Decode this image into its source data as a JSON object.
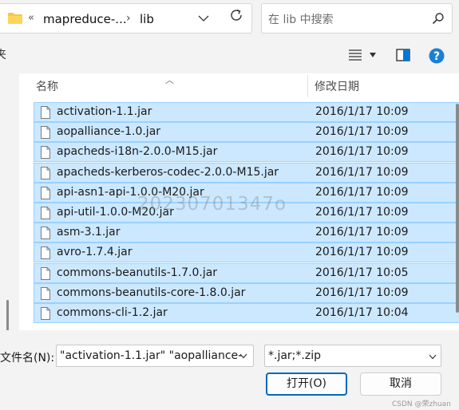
{
  "address": {
    "guillemet": "«",
    "crumbs": [
      "mapreduce-...",
      "lib"
    ],
    "separator": "›"
  },
  "search": {
    "placeholder": "在 lib 中搜索"
  },
  "toolbar": {
    "clipped_text": "夹"
  },
  "columns": {
    "name": "名称",
    "modified": "修改日期"
  },
  "files": [
    {
      "name": "activation-1.1.jar",
      "modified": "2016/1/17 10:09"
    },
    {
      "name": "aopalliance-1.0.jar",
      "modified": "2016/1/17 10:09"
    },
    {
      "name": "apacheds-i18n-2.0.0-M15.jar",
      "modified": "2016/1/17 10:09"
    },
    {
      "name": "apacheds-kerberos-codec-2.0.0-M15.jar",
      "modified": "2016/1/17 10:09"
    },
    {
      "name": "api-asn1-api-1.0.0-M20.jar",
      "modified": "2016/1/17 10:09"
    },
    {
      "name": "api-util-1.0.0-M20.jar",
      "modified": "2016/1/17 10:09"
    },
    {
      "name": "asm-3.1.jar",
      "modified": "2016/1/17 10:09"
    },
    {
      "name": "avro-1.7.4.jar",
      "modified": "2016/1/17 10:09"
    },
    {
      "name": "commons-beanutils-1.7.0.jar",
      "modified": "2016/1/17 10:05"
    },
    {
      "name": "commons-beanutils-core-1.8.0.jar",
      "modified": "2016/1/17 10:09"
    },
    {
      "name": "commons-cli-1.2.jar",
      "modified": "2016/1/17 10:04"
    }
  ],
  "watermark": "20230701347o",
  "footer": {
    "filename_label": "文件名(N):",
    "filename_value": "\"activation-1.1.jar\" \"aopalliance-",
    "filetype_value": "*.jar;*.zip",
    "open_label": "打开(O)",
    "cancel_label": "取消",
    "credit": "CSDN @荣zhuan"
  },
  "colors": {
    "selection_bg": "#cce8ff",
    "selection_border": "#99d1ff",
    "accent": "#0067c0",
    "chrome_bg": "#f3f3f3"
  },
  "icons": [
    "folder-icon",
    "dropdown-chevron-icon",
    "refresh-icon",
    "search-icon",
    "view-options-icon",
    "preview-pane-icon",
    "help-icon",
    "jar-file-icon"
  ]
}
